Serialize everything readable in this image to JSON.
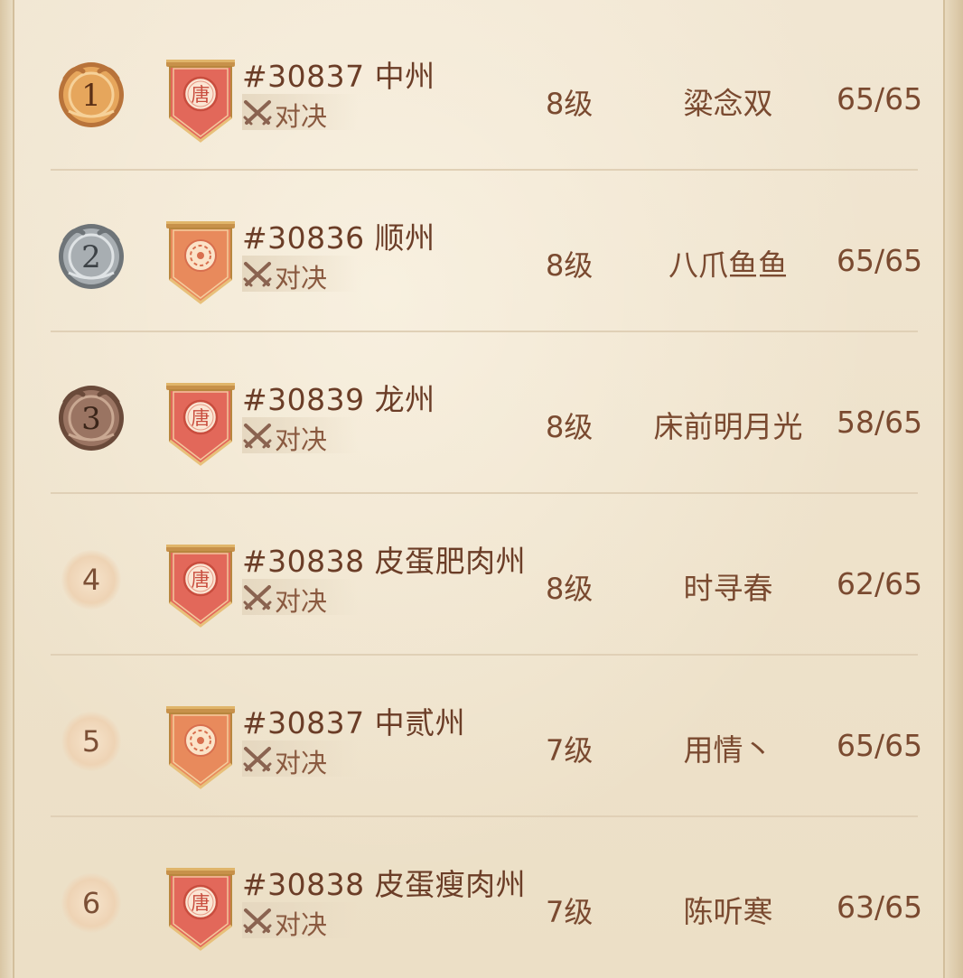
{
  "rows": [
    {
      "rank": "1",
      "medal": "gold",
      "banner": "tang-seal",
      "server": "#30837 中州",
      "mode": "对决",
      "level": "8级",
      "leader": "粱念双",
      "count": "65/65"
    },
    {
      "rank": "2",
      "medal": "silver",
      "banner": "flower-emblem",
      "server": "#30836 顺州",
      "mode": "对决",
      "level": "8级",
      "leader": "八爪鱼鱼",
      "count": "65/65"
    },
    {
      "rank": "3",
      "medal": "bronze",
      "banner": "tang-seal",
      "server": "#30839 龙州",
      "mode": "对决",
      "level": "8级",
      "leader": "床前明月光",
      "count": "58/65"
    },
    {
      "rank": "4",
      "medal": "plain",
      "banner": "tang-seal",
      "server": "#30838 皮蛋肥肉州",
      "mode": "对决",
      "level": "8级",
      "leader": "时寻春",
      "count": "62/65"
    },
    {
      "rank": "5",
      "medal": "plain",
      "banner": "flower-emblem",
      "server": "#30837 中贰州",
      "mode": "对决",
      "level": "7级",
      "leader": "用情丶",
      "count": "65/65"
    },
    {
      "rank": "6",
      "medal": "plain",
      "banner": "tang-seal",
      "server": "#30838 皮蛋瘦肉州",
      "mode": "对决",
      "level": "7级",
      "leader": "陈听寒",
      "count": "63/65"
    }
  ],
  "banner_seal_char": "唐",
  "colors": {
    "text": "#7a4a30",
    "banner_red": "#e2685a",
    "banner_orange": "#e88a5c",
    "parchment": "#efe3cc"
  },
  "icons": {
    "mode": "crossed-swords-icon",
    "medal": "rank-medal-icon",
    "banner": "server-banner-icon"
  }
}
